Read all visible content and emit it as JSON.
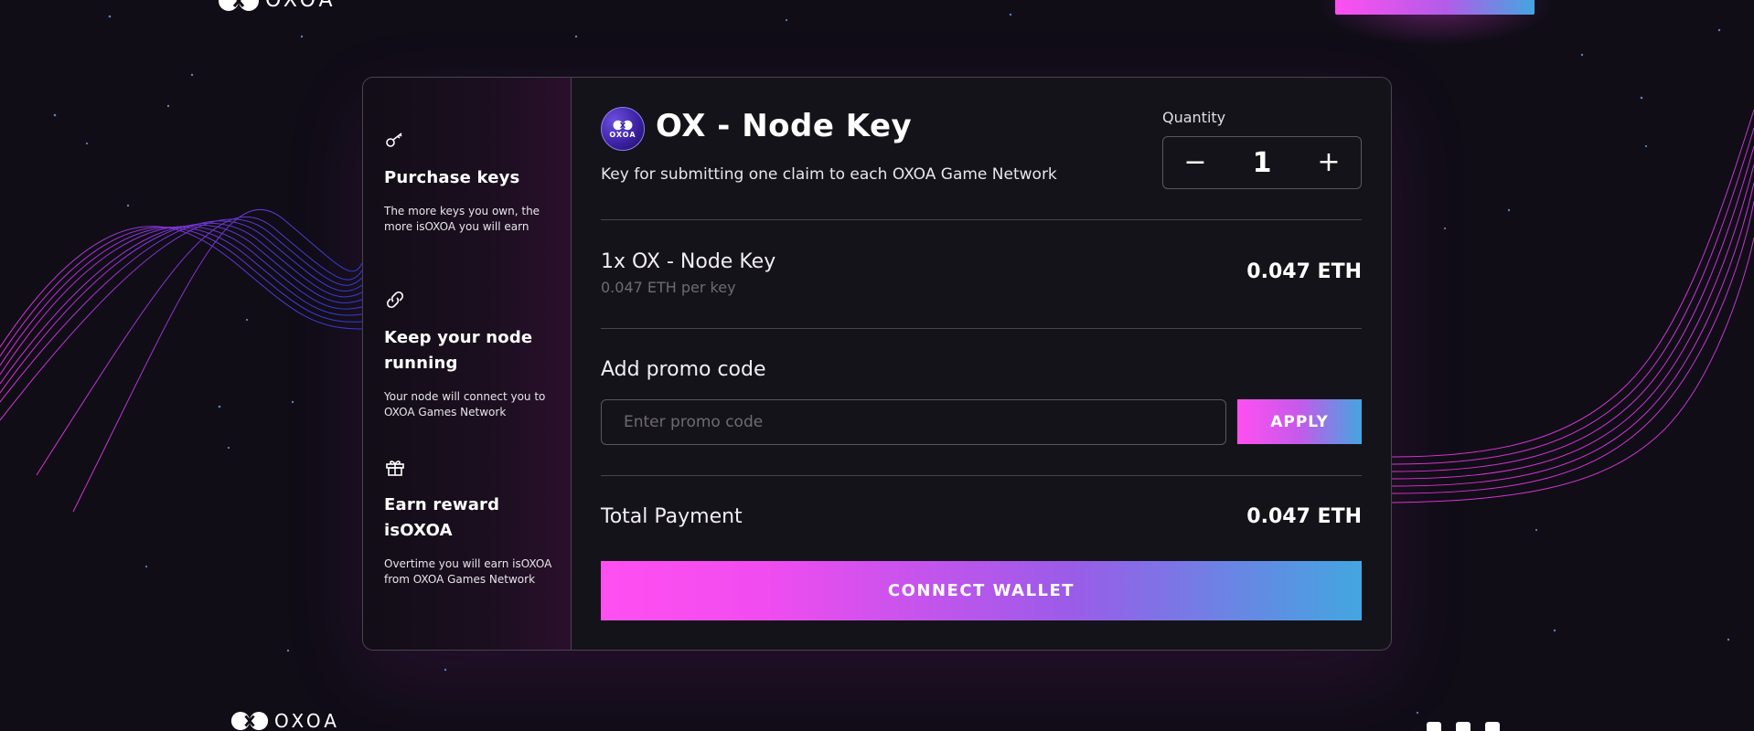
{
  "brand": {
    "logo_text": "OXOA"
  },
  "sidebar": {
    "features": [
      {
        "icon": "key-icon",
        "title": "Purchase keys",
        "desc": "The more keys you own, the more isOXOA you will earn"
      },
      {
        "icon": "link-icon",
        "title": "Keep your node running",
        "desc": "Your node will connect you to OXOA Games Network"
      },
      {
        "icon": "gift-icon",
        "title": "Earn reward isOXOA",
        "desc": "Overtime you will earn isOXOA from OXOA Games Network"
      }
    ]
  },
  "product": {
    "logo_text": "OXOA",
    "title": "OX - Node Key",
    "subtitle": "Key for submitting one claim to each OXOA Game Network"
  },
  "quantity": {
    "label": "Quantity",
    "value": "1",
    "minus": "−",
    "plus": "+"
  },
  "line_item": {
    "name": "1x OX - Node Key",
    "unit_price": "0.047 ETH per key",
    "price": "0.047 ETH"
  },
  "promo": {
    "label": "Add promo code",
    "placeholder": "Enter promo code",
    "apply_label": "APPLY"
  },
  "total": {
    "label": "Total Payment",
    "value": "0.047 ETH"
  },
  "cta": {
    "label": "CONNECT WALLET"
  },
  "colors": {
    "background": "#100d17",
    "accent_pink": "#ff4ff1",
    "accent_blue": "#43a6e0",
    "card": "#16141b"
  }
}
